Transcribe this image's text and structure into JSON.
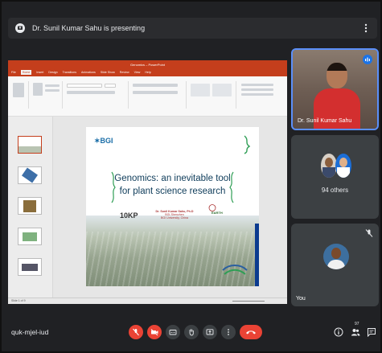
{
  "banner": {
    "presenting_text": "Dr. Sunil Kumar Sahu is presenting"
  },
  "ppt": {
    "window_title": "Genomics – PowerPoint",
    "tabs": [
      "File",
      "Home",
      "Insert",
      "Design",
      "Transitions",
      "Animations",
      "Slide Show",
      "Review",
      "View",
      "Help"
    ],
    "active_tab": "Home",
    "status_text": "Slide 1 of 9"
  },
  "slide": {
    "logo_text": "✶BGI",
    "title_line1": "Genomics: an inevitable tool",
    "title_line2": "for plant science research",
    "logo_10kp": "10KP",
    "author_line1": "Dr. Sunil Kumar Sahu, Ph.D",
    "author_line2": "BGI-Shenzhen",
    "author_line3": "BGI University, China",
    "earth_text": "EARTH"
  },
  "participants": {
    "presenter_name": "Dr. Sunil Kumar Sahu",
    "others_label": "94 others",
    "self_label": "You"
  },
  "bottom_bar": {
    "meeting_code": "quk-mjel-iud",
    "participant_count": "97"
  },
  "colors": {
    "background": "#202124",
    "ppt_accent": "#c43e1c",
    "mute_red": "#ea4335",
    "active_tile_border": "#5b8ff9"
  }
}
